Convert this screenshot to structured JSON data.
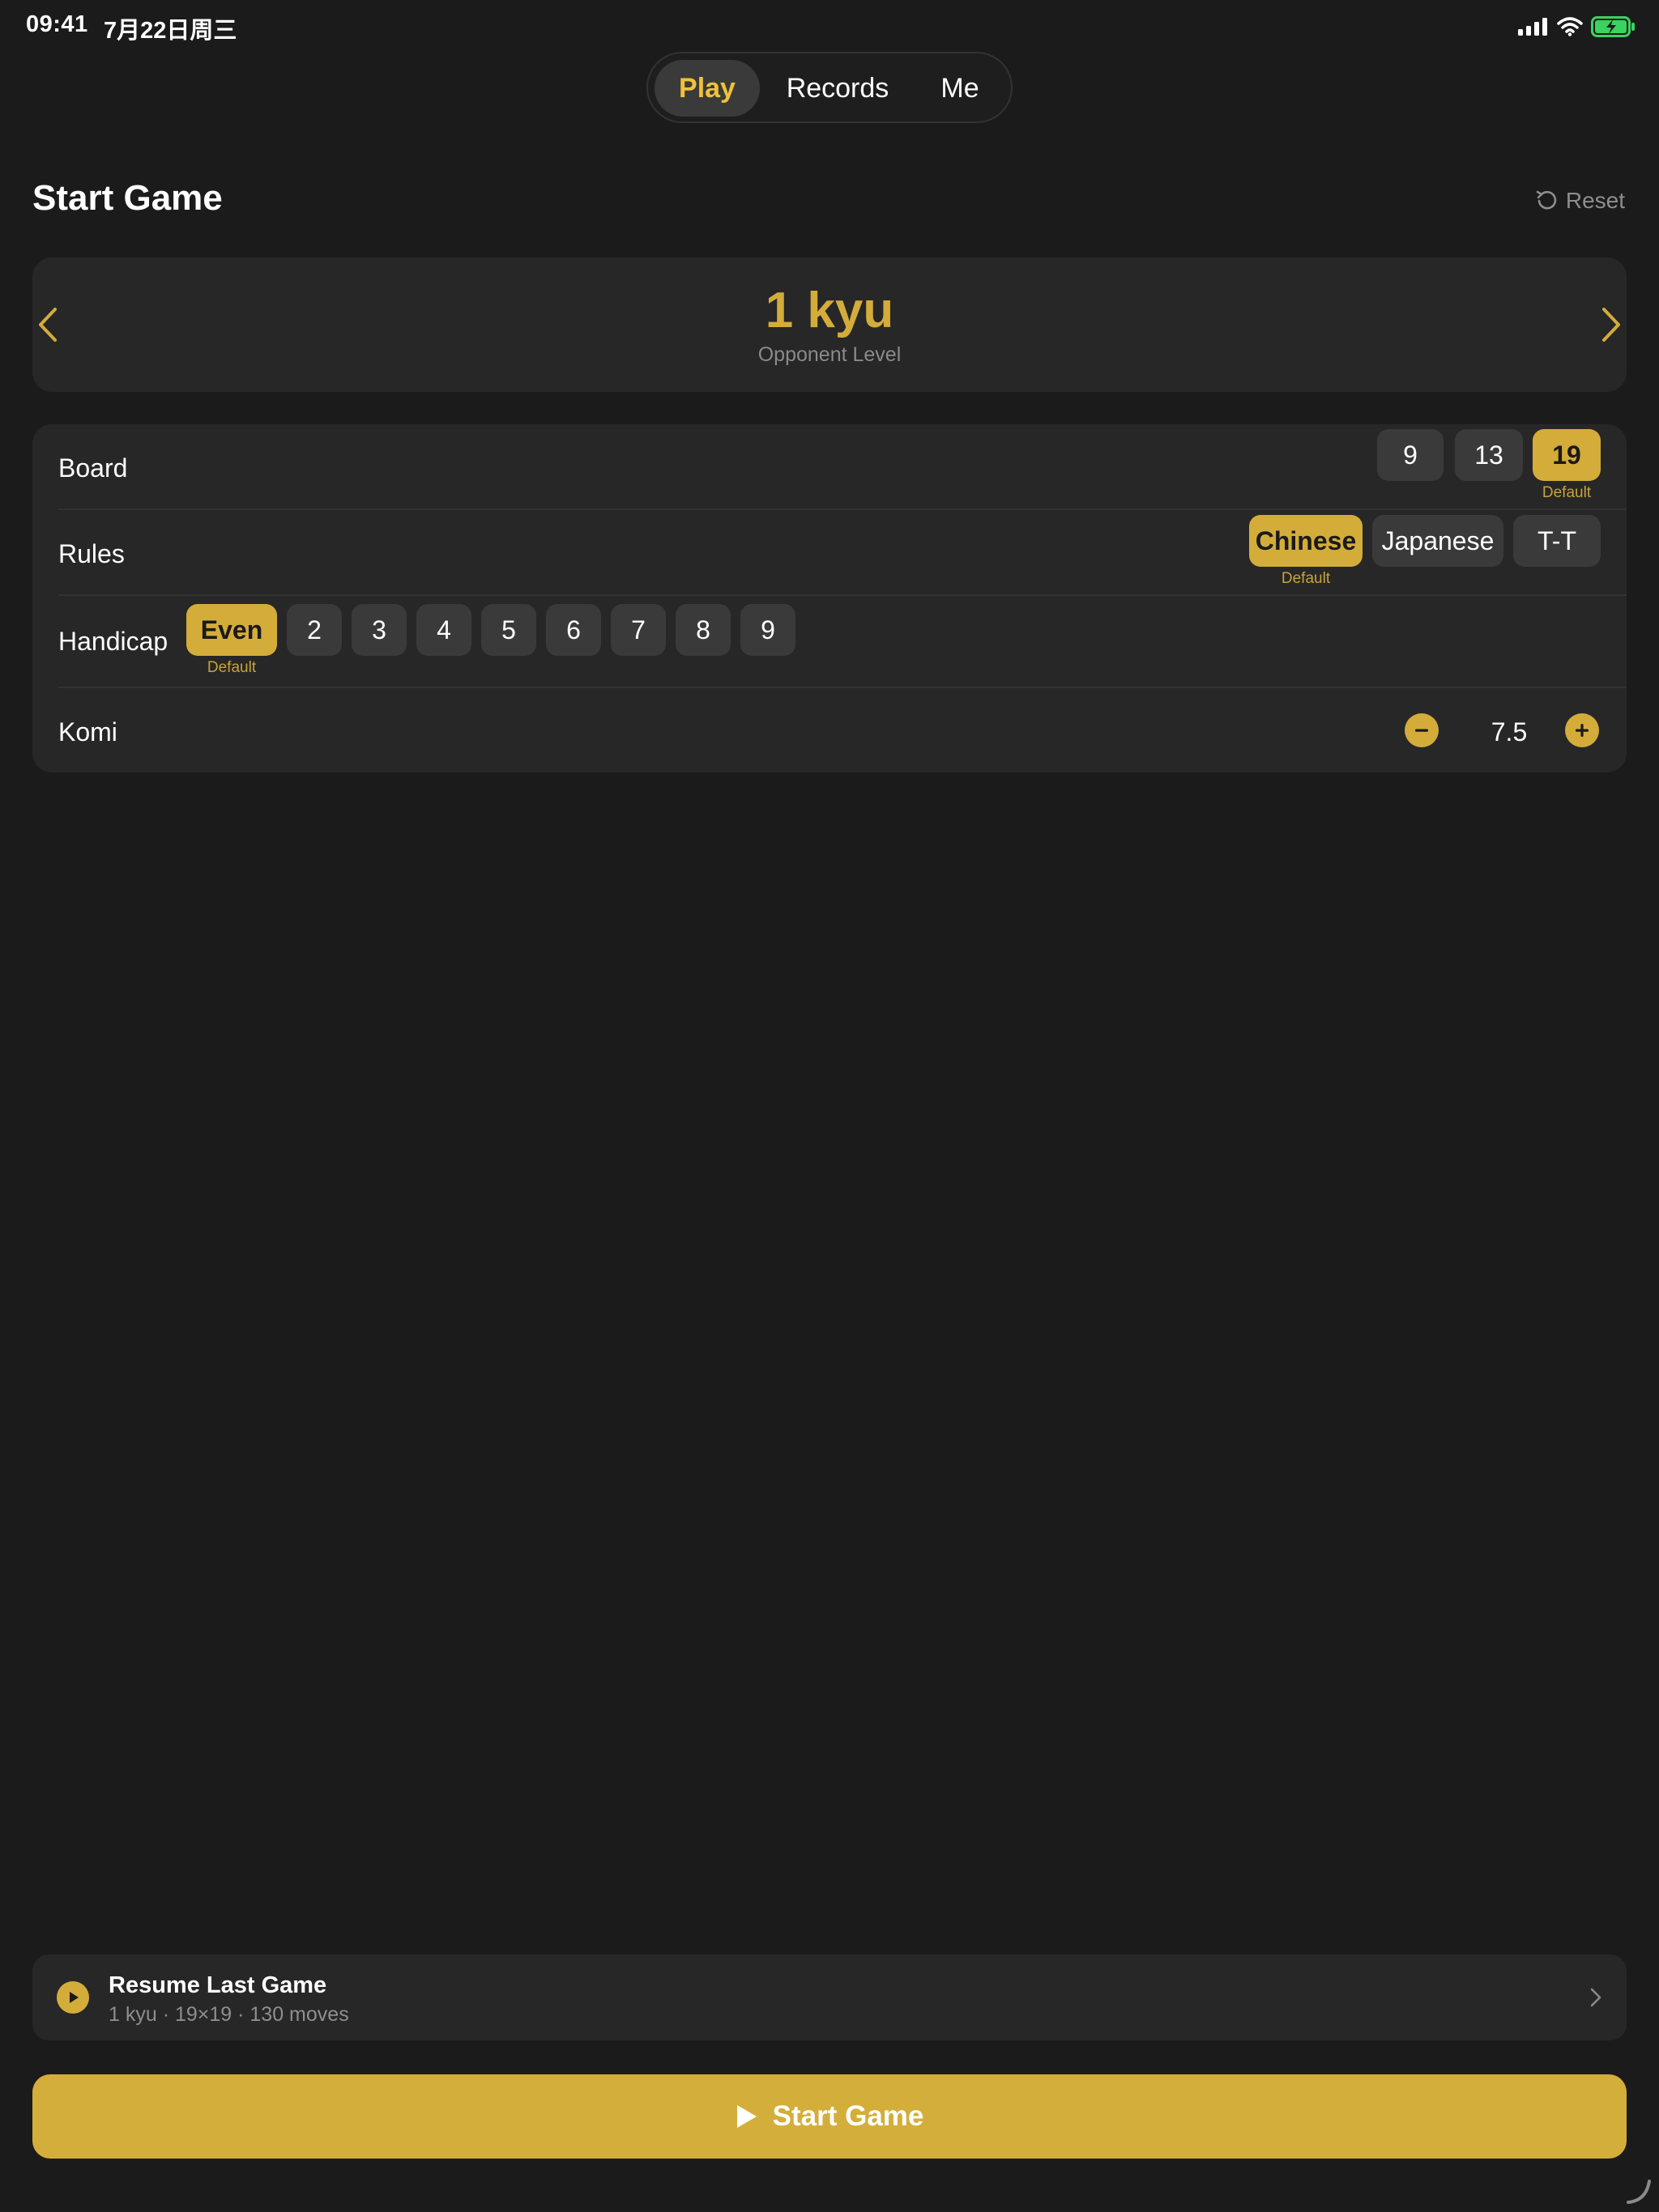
{
  "status_bar": {
    "time": "09:41",
    "date": "7月22日周三"
  },
  "tabs": [
    {
      "label": "Play",
      "active": true
    },
    {
      "label": "Records",
      "active": false
    },
    {
      "label": "Me",
      "active": false
    }
  ],
  "header": {
    "title": "Start Game",
    "reset_label": "Reset"
  },
  "opponent": {
    "level": "1 kyu",
    "caption": "Opponent Level"
  },
  "settings": {
    "board": {
      "label": "Board",
      "options": [
        "9",
        "13",
        "19"
      ],
      "selected": "19",
      "default_label": "Default"
    },
    "rules": {
      "label": "Rules",
      "options": [
        "Chinese",
        "Japanese",
        "T-T"
      ],
      "selected": "Chinese",
      "default_label": "Default"
    },
    "handicap": {
      "label": "Handicap",
      "options": [
        "Even",
        "2",
        "3",
        "4",
        "5",
        "6",
        "7",
        "8",
        "9"
      ],
      "selected": "Even",
      "default_label": "Default"
    },
    "komi": {
      "label": "Komi",
      "value": "7.5"
    }
  },
  "resume": {
    "title": "Resume Last Game",
    "subtitle": "1 kyu · 19×19 · 130 moves"
  },
  "start_button": {
    "label": "Start Game"
  },
  "colors": {
    "accent": "#d4ac3a",
    "background": "#1b1b1b",
    "card": "#272727",
    "chip": "#3a3a3a"
  }
}
